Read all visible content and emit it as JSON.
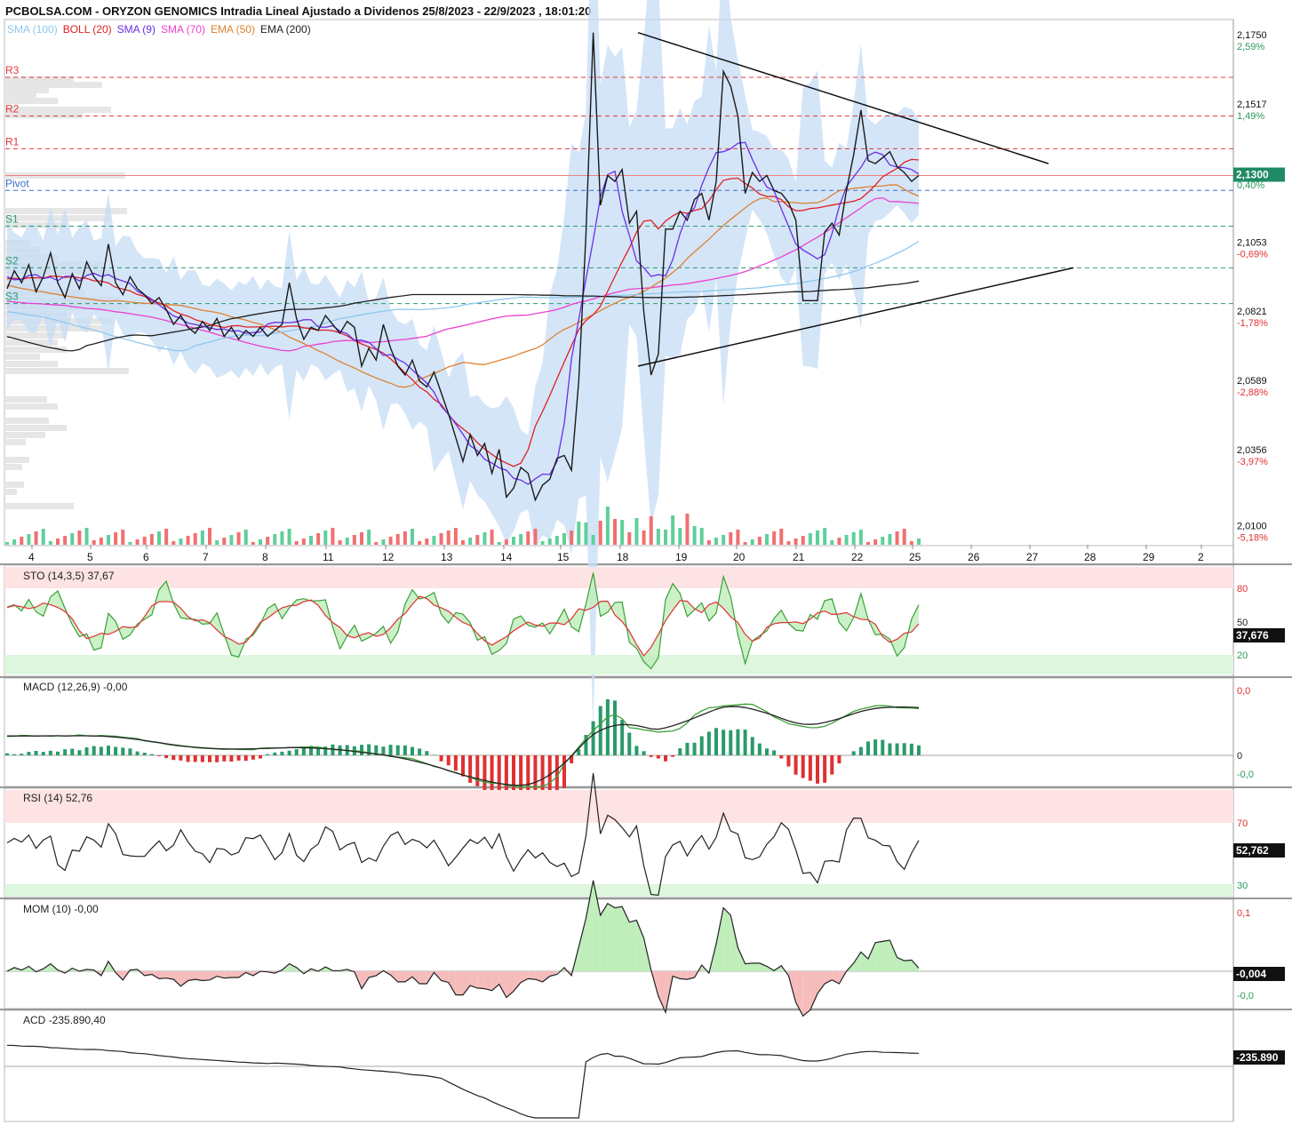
{
  "title": "PCBOLSA.COM - ORYZON GENOMICS Intradia Lineal Ajustado a Dividenos 25/8/2023 - 22/9/2023 , 18:01:20",
  "legend": [
    {
      "label": "SMA (100)",
      "color": "#8fc8ee"
    },
    {
      "label": "BOLL (20)",
      "color": "#e02020"
    },
    {
      "label": "SMA (9)",
      "color": "#6a2ee8"
    },
    {
      "label": "SMA (70)",
      "color": "#ee3fd0"
    },
    {
      "label": "EMA (50)",
      "color": "#e0802e"
    },
    {
      "label": "EMA (200)",
      "color": "#222222"
    }
  ],
  "last_price_label": "2,1300",
  "pivot_labels": [
    "R3",
    "R2",
    "R1",
    "Pivot",
    "S1",
    "S2",
    "S3"
  ],
  "colors": {
    "price": "#1a1a1a",
    "boll_band": "#c5dcf5",
    "pivot_red": "#e23b3b",
    "pivot_blue": "#3a6fd0",
    "pivot_green": "#2a9a6a",
    "overbought": "#fde3e3",
    "oversold": "#ddf6dd",
    "up_volume": "#5fcf9a",
    "down_volume": "#f07070"
  },
  "chart_data": [
    {
      "type": "line",
      "name": "price",
      "x_ticks": [
        "4",
        "5",
        "6",
        "7",
        "8",
        "11",
        "12",
        "13",
        "14",
        "15",
        "18",
        "19",
        "20",
        "21",
        "22",
        "25",
        "26",
        "27",
        "28",
        "29",
        "2"
      ],
      "y_ticks": [
        {
          "value": "2,1750",
          "pct": "2,59%"
        },
        {
          "value": "2,1517",
          "pct": "1,49%"
        },
        {
          "value": "",
          "pct": "0,40%"
        },
        {
          "value": "2,1053",
          "pct": "-0,69%"
        },
        {
          "value": "2,0821",
          "pct": "-1,78%"
        },
        {
          "value": "2,0589",
          "pct": "-2,88%"
        },
        {
          "value": "2,0356",
          "pct": "-3,97%"
        },
        {
          "value": "2,0100",
          "pct": "-5,18%"
        }
      ],
      "ylim": [
        2.006,
        2.18
      ],
      "pivots": {
        "R3": 2.163,
        "R2": 2.15,
        "R1": 2.139,
        "Pivot": 2.125,
        "S1": 2.113,
        "S2": 2.099,
        "S3": 2.087
      },
      "last_price": 2.13,
      "price_path": [
        2.092,
        2.098,
        2.094,
        2.1,
        2.091,
        2.096,
        2.104,
        2.094,
        2.089,
        2.097,
        2.092,
        2.101,
        2.096,
        2.093,
        2.107,
        2.094,
        2.09,
        2.096,
        2.092,
        2.09,
        2.087,
        2.089,
        2.085,
        2.08,
        2.083,
        2.079,
        2.077,
        2.081,
        2.078,
        2.082,
        2.076,
        2.079,
        2.075,
        2.078,
        2.076,
        2.079,
        2.076,
        2.078,
        2.08,
        2.094,
        2.082,
        2.075,
        2.079,
        2.078,
        2.083,
        2.08,
        2.077,
        2.081,
        2.079,
        2.066,
        2.072,
        2.068,
        2.08,
        2.072,
        2.066,
        2.063,
        2.068,
        2.061,
        2.059,
        2.064,
        2.057,
        2.05,
        2.042,
        2.034,
        2.043,
        2.036,
        2.04,
        2.03,
        2.038,
        2.022,
        2.025,
        2.032,
        2.03,
        2.021,
        2.026,
        2.028,
        2.035,
        2.036,
        2.031,
        2.061,
        2.11,
        2.178,
        2.12,
        2.13,
        2.128,
        2.132,
        2.114,
        2.118,
        2.084,
        2.063,
        2.07,
        2.112,
        2.112,
        2.118,
        2.115,
        2.122,
        2.124,
        2.115,
        2.128,
        2.165,
        2.16,
        2.15,
        2.124,
        2.131,
        2.128,
        2.13,
        2.125,
        2.124,
        2.121,
        2.115,
        2.088,
        2.088,
        2.088,
        2.111,
        2.114,
        2.11,
        2.125,
        2.137,
        2.152,
        2.135,
        2.134,
        2.136,
        2.138,
        2.133,
        2.131,
        2.128,
        2.13
      ],
      "trendline_upper": [
        [
          2.178,
          0.0
        ],
        [
          2.134,
          1.0
        ]
      ],
      "trendline_lower": [
        [
          2.066,
          0.0
        ],
        [
          2.099,
          1.0
        ]
      ]
    },
    {
      "type": "line",
      "name": "STO (14,3,5)",
      "value_label": "37,67",
      "last_label": "37,676",
      "levels": [
        "80",
        "50",
        "20"
      ]
    },
    {
      "type": "area",
      "name": "MACD (12,26,9)",
      "value_label": "-0,00",
      "levels": [
        "0,0",
        "0",
        "-0,0"
      ]
    },
    {
      "type": "line",
      "name": "RSI (14)",
      "value_label": "52,76",
      "last_label": "52,762",
      "levels": [
        "70",
        "30"
      ]
    },
    {
      "type": "area",
      "name": "MOM (10)",
      "value_label": "-0,00",
      "last_label": "-0,004",
      "levels": [
        "0,1",
        "-0,0"
      ]
    },
    {
      "type": "line",
      "name": "ACD",
      "value_label": "-235.890,40",
      "last_label": "-235.890"
    }
  ]
}
